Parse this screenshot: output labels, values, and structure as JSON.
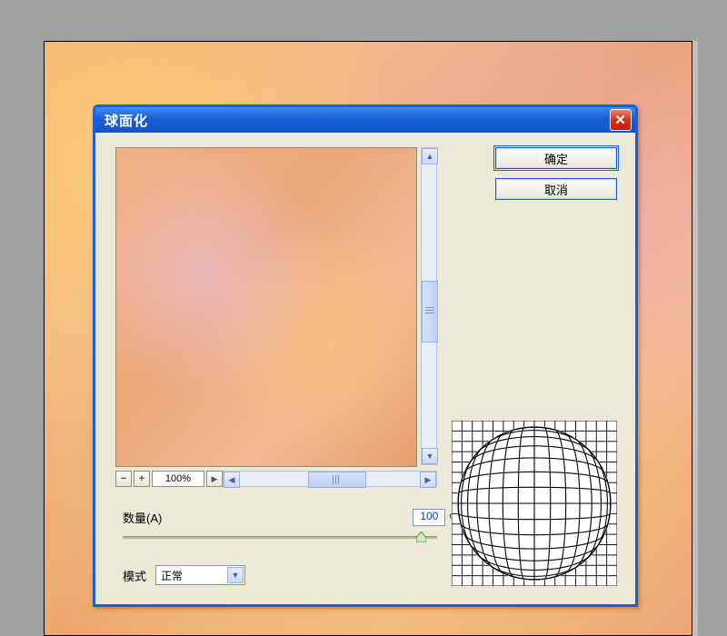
{
  "dialog": {
    "title": "球面化",
    "ok_label": "确定",
    "cancel_label": "取消",
    "zoom_value": "100%",
    "amount_label": "数量(A)",
    "amount_value": "100",
    "amount_unit": "%",
    "mode_label": "模式",
    "mode_value": "正常"
  }
}
